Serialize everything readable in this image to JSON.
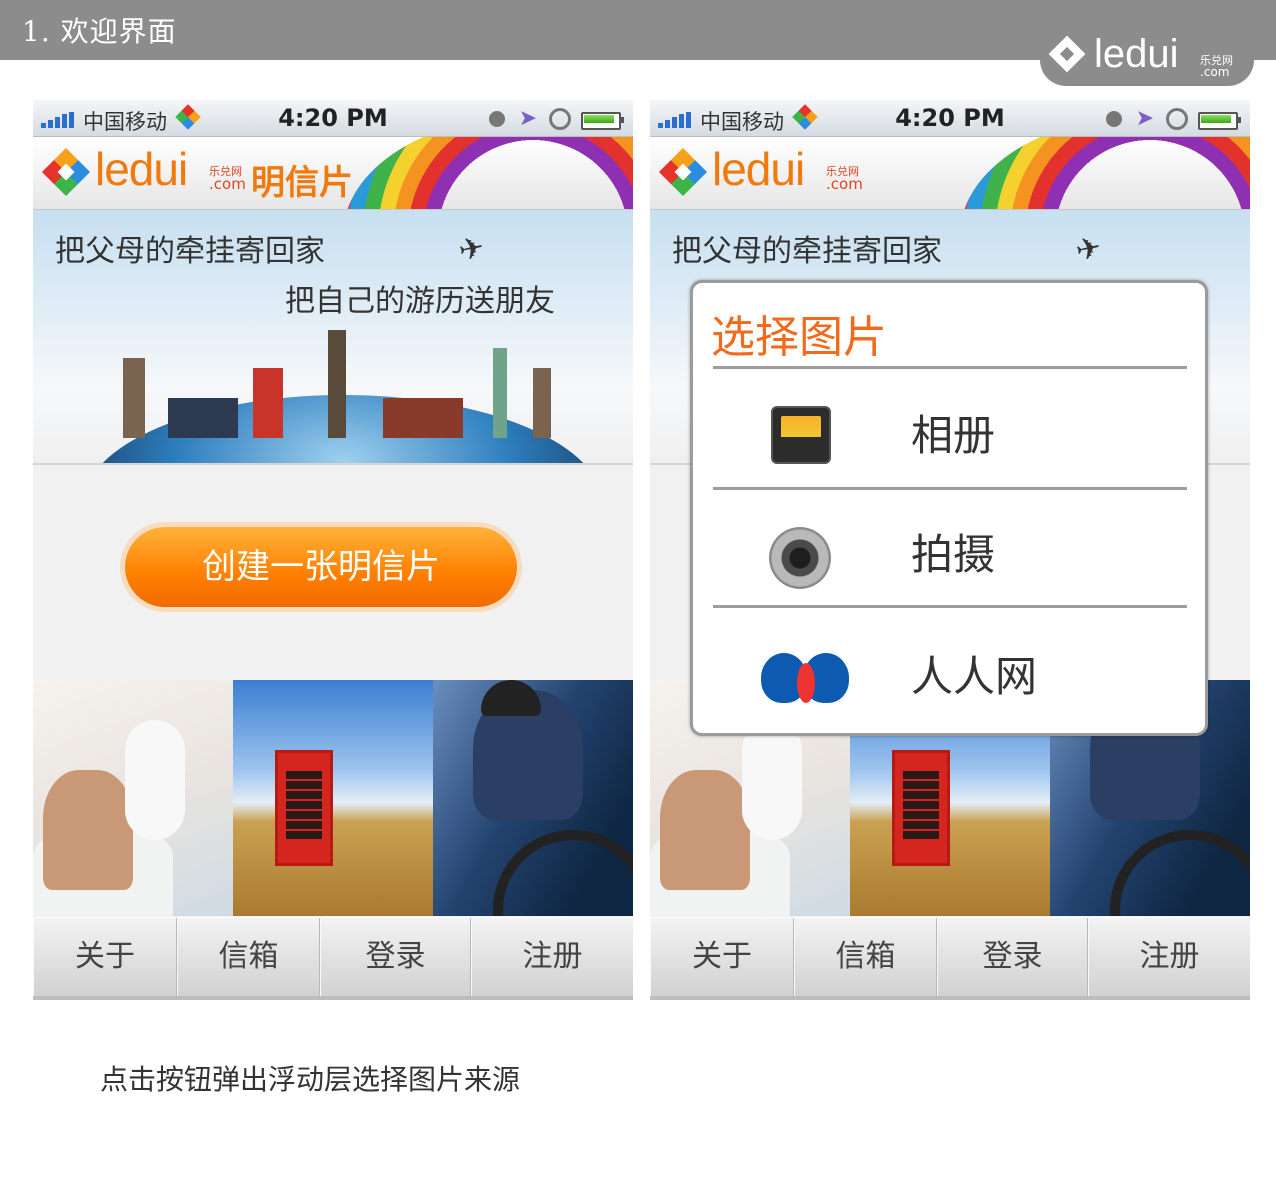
{
  "page_title": "1. 欢迎界面",
  "brand": {
    "word": "ledui",
    "cn": "乐兑网",
    "com": ".com"
  },
  "status_bar": {
    "carrier": "中国移动",
    "time": "4:20 PM"
  },
  "header": {
    "logo_word": "ledui",
    "logo_cn": "乐兑网",
    "logo_com": ".com",
    "app_title": "明信片"
  },
  "banner": {
    "slogan1": "把父母的牵挂寄回家",
    "slogan2": "把自己的游历送朋友"
  },
  "cta": {
    "label": "创建一张明信片"
  },
  "tabs": [
    "关于",
    "信箱",
    "登录",
    "注册"
  ],
  "dialog": {
    "title": "选择图片",
    "options": [
      {
        "label": "相册",
        "icon": "album-icon"
      },
      {
        "label": "拍摄",
        "icon": "camera-icon"
      },
      {
        "label": "人人网",
        "icon": "renren-icon"
      }
    ]
  },
  "caption": "点击按钮弹出浮动层选择图片来源",
  "colors": {
    "accent": "#f26a1b",
    "button": "#ff7f00",
    "topbar": "#8c8c8c"
  }
}
